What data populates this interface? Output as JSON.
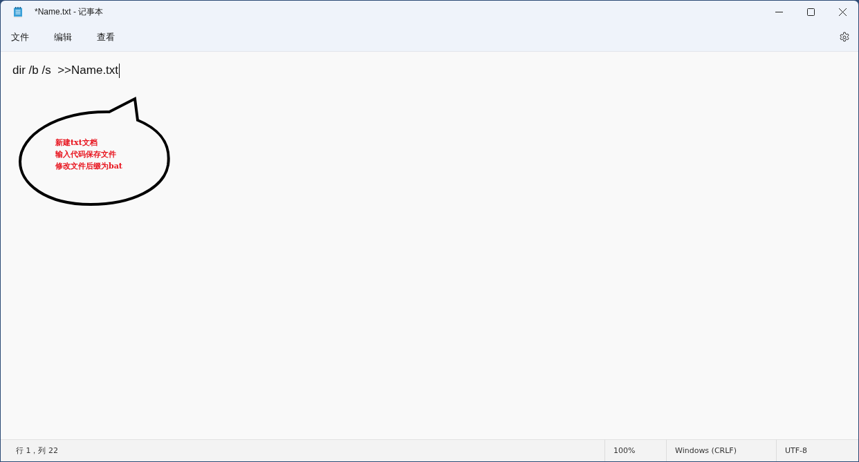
{
  "window": {
    "title": "*Name.txt - 记事本"
  },
  "menu": [
    {
      "label": "文件"
    },
    {
      "label": "编辑"
    },
    {
      "label": "查看"
    }
  ],
  "editor": {
    "text": "dir /b /s  >>Name.txt"
  },
  "annotation": {
    "lines": [
      "新建txt文档",
      "输入代码保存文件",
      "修改文件后缀为bat"
    ]
  },
  "status_bar": {
    "position": "行 1，列 22",
    "zoom": "100%",
    "line_ending": "Windows (CRLF)",
    "encoding": "UTF-8"
  }
}
